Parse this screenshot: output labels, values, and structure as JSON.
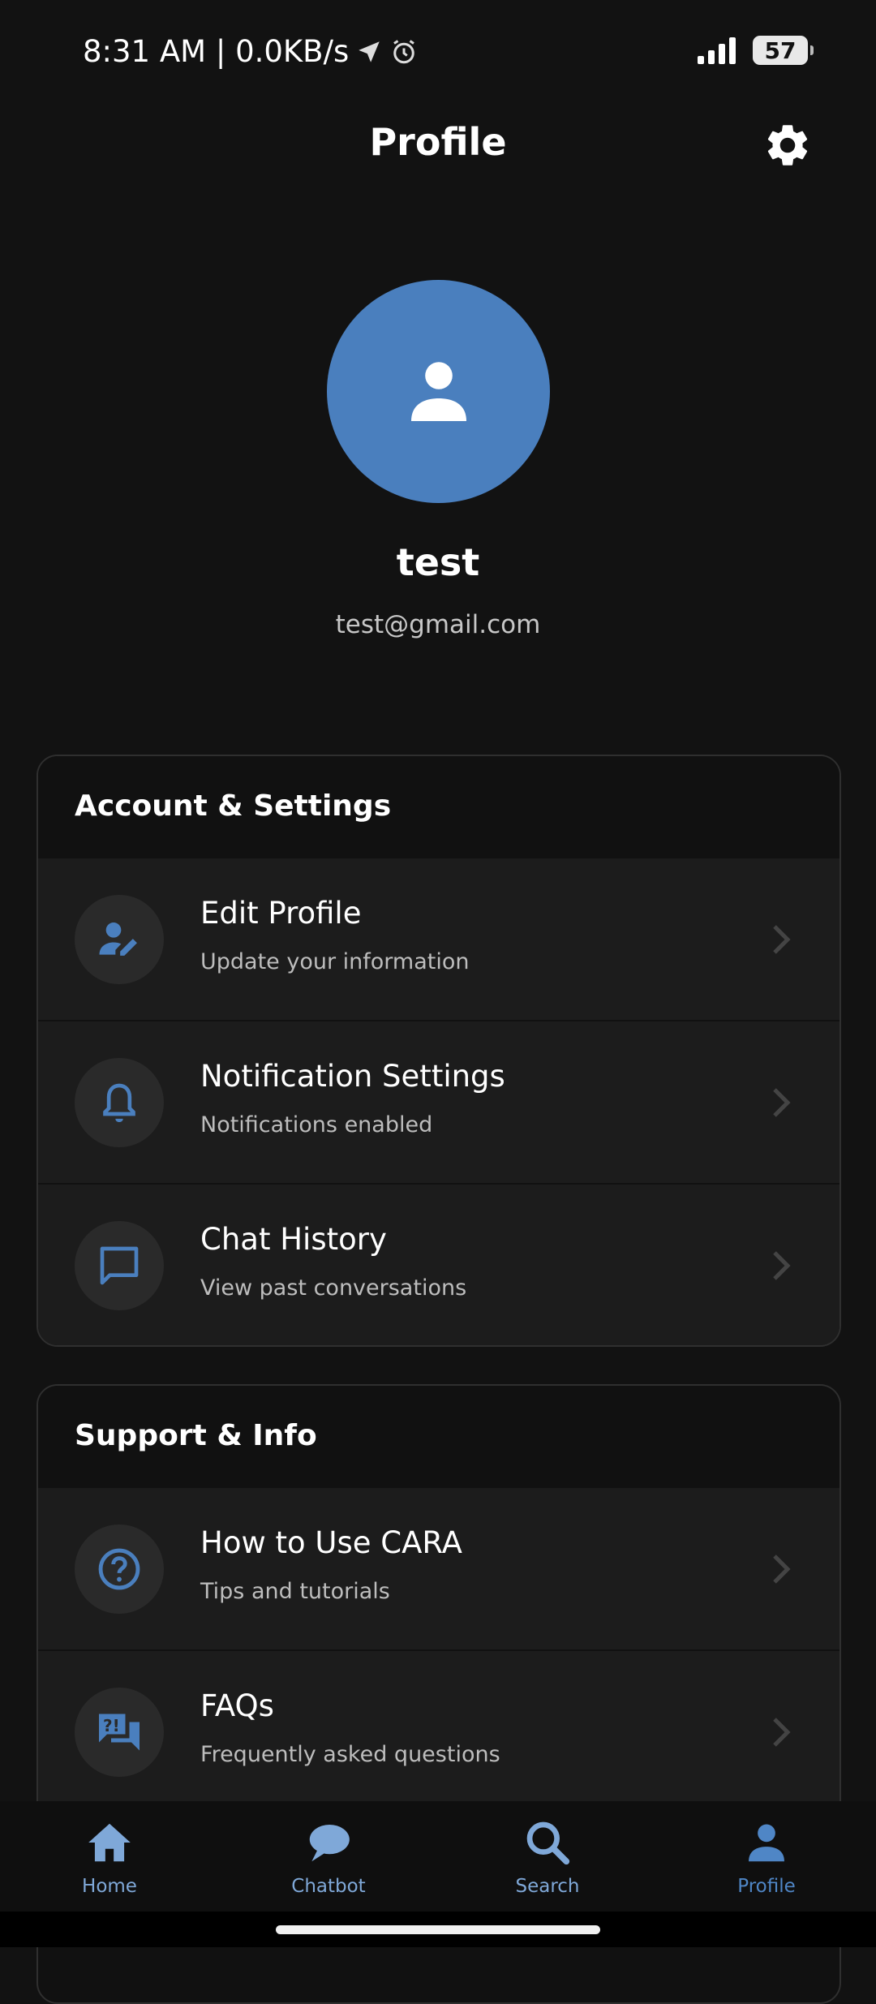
{
  "status": {
    "time_text": "8:31 AM | 0.0KB/s",
    "battery": "57"
  },
  "header": {
    "title": "Profile"
  },
  "user": {
    "name": "test",
    "email": "test@gmail.com"
  },
  "account_section": {
    "title": "Account & Settings",
    "items": [
      {
        "title": "Edit Profile",
        "subtitle": "Update your information",
        "icon": "edit-person-icon"
      },
      {
        "title": "Notification Settings",
        "subtitle": "Notifications enabled",
        "icon": "bell-icon"
      },
      {
        "title": "Chat History",
        "subtitle": "View past conversations",
        "icon": "chat-bubble-icon"
      }
    ]
  },
  "support_section": {
    "title": "Support & Info",
    "items": [
      {
        "title": "How to Use CARA",
        "subtitle": "Tips and tutorials",
        "icon": "help-circle-icon"
      },
      {
        "title": "FAQs",
        "subtitle": "Frequently asked questions",
        "icon": "faq-icon"
      }
    ]
  },
  "nav": {
    "items": [
      {
        "label": "Home",
        "icon": "home-icon"
      },
      {
        "label": "Chatbot",
        "icon": "chat-icon"
      },
      {
        "label": "Search",
        "icon": "search-icon"
      },
      {
        "label": "Profile",
        "icon": "person-icon",
        "active": true
      }
    ]
  },
  "colors": {
    "accent": "#4a7fbe",
    "background": "#121212",
    "card_row": "#1c1c1c"
  }
}
